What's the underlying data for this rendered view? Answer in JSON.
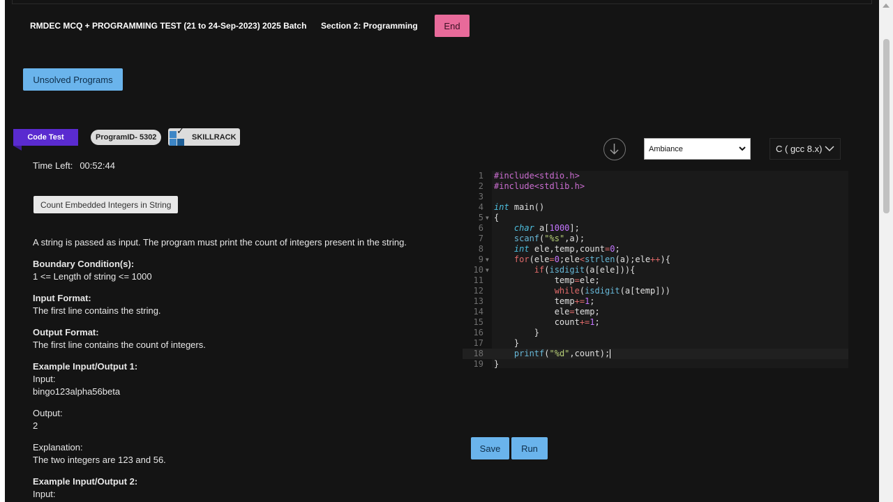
{
  "header": {
    "test_title": "RMDEC MCQ + PROGRAMMING TEST (21 to 24-Sep-2023) 2025 Batch",
    "section_title": "Section 2: Programming",
    "end_label": "End"
  },
  "unsolved_label": "Unsolved Programs",
  "badges": {
    "code_test": "Code Test",
    "program_id": "ProgramID- 5302",
    "skillrack": "SKILLRACK"
  },
  "timer": {
    "label": "Time Left:",
    "value": "00:52:44"
  },
  "problem": {
    "title": "Count Embedded Integers in String",
    "statement": "A string is passed as input. The program must print the count of integers present in the string.",
    "boundary_heading": "Boundary Condition(s):",
    "boundary_text": "1 <= Length of string <= 1000",
    "input_heading": "Input Format:",
    "input_text": "The first line contains the string.",
    "output_heading": "Output Format:",
    "output_text": "The first line contains the count of integers.",
    "example1_heading": "Example Input/Output 1:",
    "example1_input_label": "Input:",
    "example1_input": "bingo123alpha56beta",
    "example1_output_label": "Output:",
    "example1_output": "2",
    "explanation_label": "Explanation:",
    "explanation_text": "The two integers are 123 and 56.",
    "example2_heading": "Example Input/Output 2:",
    "example2_input_label": "Input:"
  },
  "editor": {
    "theme_selected": "Ambiance",
    "language_selected": "C ( gcc 8.x)",
    "line_numbers": [
      "1",
      "2",
      "3",
      "4",
      "5",
      "6",
      "7",
      "8",
      "9",
      "10",
      "11",
      "12",
      "13",
      "14",
      "15",
      "16",
      "17",
      "18",
      "19"
    ]
  },
  "actions": {
    "save_label": "Save",
    "run_label": "Run"
  },
  "icons": {
    "down_arrow": "arrow-down-circle-icon",
    "chevron": "chevron-down-icon",
    "logo": "skillrack-logo-icon"
  },
  "colors": {
    "background": "#141414",
    "accent_blue": "#6ab4ec",
    "end_pink": "#e86a9a",
    "ribbon_purple": "#5a2bd0"
  }
}
